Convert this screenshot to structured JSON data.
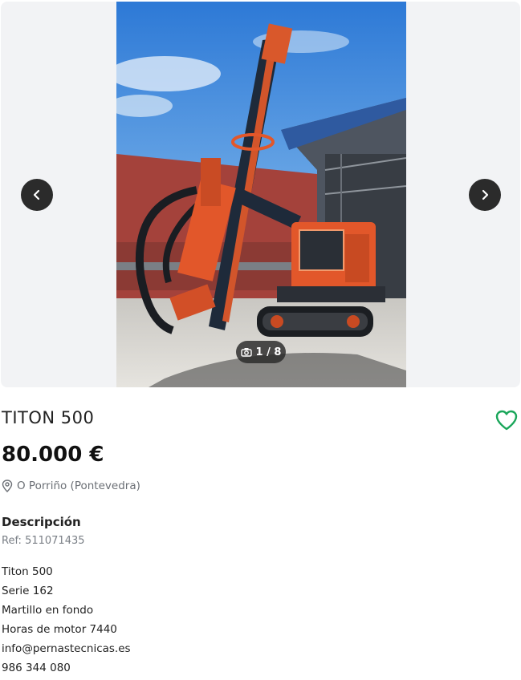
{
  "listing": {
    "title": "TITON 500",
    "price": "80.000 €",
    "location": "O Porriño (Pontevedra)",
    "description_heading": "Descripción",
    "ref": "Ref: 511071435",
    "description_lines": [
      "Titon 500",
      "Serie 162",
      "Martillo en fondo",
      "Horas de motor 7440",
      "info@pernastecnicas.es",
      "986 344 080"
    ]
  },
  "gallery": {
    "counter": "1 / 8",
    "prev_icon": "chevron-left-icon",
    "next_icon": "chevron-right-icon",
    "camera_icon": "camera-icon"
  },
  "colors": {
    "accent_favorite": "#1aa65a",
    "machine_orange": "#e2572a"
  }
}
